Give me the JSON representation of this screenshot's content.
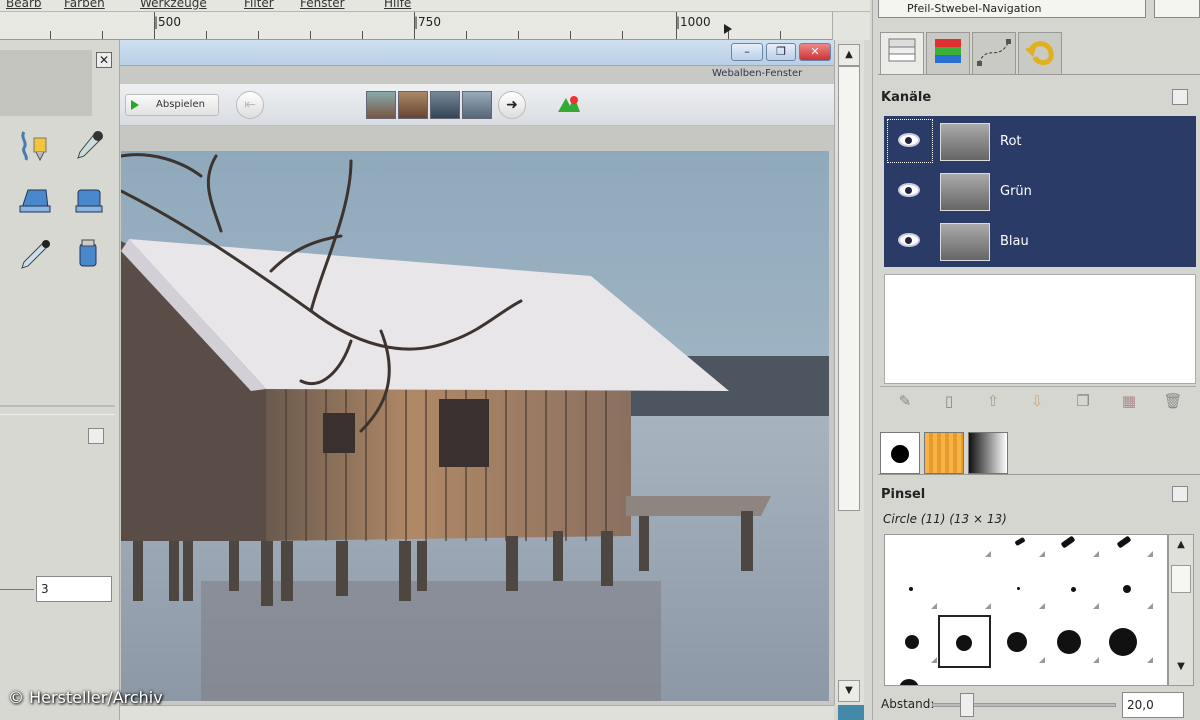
{
  "menubar": {
    "items": [
      "Bearb",
      "Farben",
      "Werkzeuge",
      "Filter",
      "Fenster",
      "Hilfe"
    ]
  },
  "ruler": {
    "labels": [
      "|500",
      "|750",
      "|1000"
    ]
  },
  "toolbox": {
    "spin_value": "3"
  },
  "browser": {
    "link_text": "Webalben-Fenster",
    "play_label": "Abspielen",
    "min": "–",
    "max": "❐",
    "close": "✕"
  },
  "dock": {
    "image_combo": "Pfeil-Stwebel-Navigation",
    "channels": {
      "title": "Kanäle",
      "items": [
        {
          "label": "Rot"
        },
        {
          "label": "Grün"
        },
        {
          "label": "Blau"
        }
      ]
    },
    "brushes": {
      "title": "Pinsel",
      "current": "Circle (11) (13 × 13)",
      "spacing_label": "Abstand:",
      "spacing_value": "20,0"
    }
  },
  "credit": "© Hersteller/Archiv",
  "colors": {
    "selection": "#2a3b68",
    "accent_orange": "#f2b24a"
  }
}
